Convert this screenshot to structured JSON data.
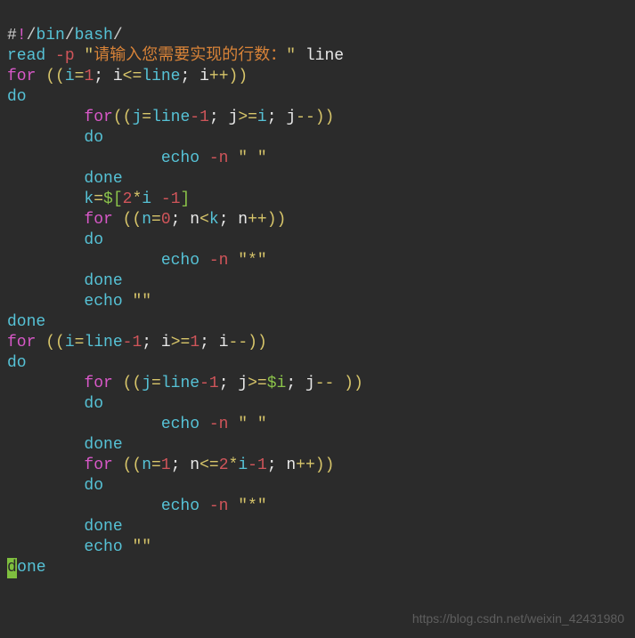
{
  "shebang": {
    "hash": "#",
    "bang": "!",
    "slash": "/",
    "bin": "bin",
    "bash": "bash"
  },
  "l2": {
    "read": "read ",
    "p": "-p ",
    "q": "\"",
    "prompt": "请输入您需要实现的行数：",
    "q2": "\"",
    "line": " line"
  },
  "l3": {
    "for": "for ",
    "p": "((",
    "ieq": "i",
    "eq": "=",
    "one": "1",
    "sc1": "; i",
    "le": "<=",
    "lin": "line",
    "sc2": "; i",
    "pp": "++",
    "cp": "))"
  },
  "l4": "do",
  "l5": {
    "for": "        for",
    "pp": "((",
    "jeq": "j",
    "eq": "=",
    "line": "line",
    "minus": "-",
    "one": "1",
    "sc1": "; j",
    "ge": ">=",
    "i": "i",
    "sc2": "; j",
    "mm": "--",
    "cp": "))"
  },
  "l6": "        do",
  "l7": {
    "echo": "                echo ",
    "n": "-n ",
    "q": "\" \""
  },
  "l8": "        done",
  "l9": {
    "pre": "        ",
    "k": "k",
    "eq": "=",
    "d": "$[",
    "two": "2",
    "mul": "*",
    "i": "i ",
    "minus": "-",
    "one": "1",
    "rb": "]"
  },
  "l10": {
    "for": "        for ",
    "p": "((",
    "n": "n",
    "eq": "=",
    "zero": "0",
    "sc1": "; n",
    "lt": "<",
    "k": "k",
    "sc2": "; n",
    "pp": "++",
    "cp": "))"
  },
  "l11": "        do",
  "l12": {
    "echo": "                echo ",
    "n": "-n ",
    "q": "\"*\""
  },
  "l13": "        done",
  "l14": {
    "echo": "        echo ",
    "q": "\"\""
  },
  "l15": "done",
  "l16": {
    "for": "for ",
    "p": "((",
    "ieq": "i",
    "eq": "=",
    "line": "line",
    "minus": "-",
    "one": "1",
    "sc1": "; i",
    "ge": ">=",
    "one2": "1",
    "sc2": "; i",
    "mm": "--",
    "cp": "))"
  },
  "l17": "do",
  "l18": {
    "for": "        for ",
    "p": "((",
    "j": "j",
    "eq": "=",
    "line": "line",
    "minus": "-",
    "one": "1",
    "sc1": "; j",
    "ge": ">=",
    "di": "$i",
    "sc2": "; j",
    "mm": "--",
    "sp": " ",
    "cp": "))"
  },
  "l19": "        do",
  "l20": {
    "echo": "                echo ",
    "n": "-n ",
    "q": "\" \""
  },
  "l21": "        done",
  "l22": {
    "for": "        for ",
    "p": "((",
    "n": "n",
    "eq": "=",
    "one": "1",
    "sc1": "; n",
    "le": "<=",
    "two": "2",
    "mul": "*",
    "i": "i",
    "minus": "-",
    "one2": "1",
    "sc2": "; n",
    "pp": "++",
    "cp": "))"
  },
  "l23": "        do",
  "l24": {
    "echo": "                echo ",
    "n": "-n ",
    "q": "\"*\""
  },
  "l25": "        done",
  "l26": {
    "echo": "        echo ",
    "q": "\"\""
  },
  "l27": {
    "d": "d",
    "one": "one"
  },
  "watermark": "https://blog.csdn.net/weixin_42431980"
}
